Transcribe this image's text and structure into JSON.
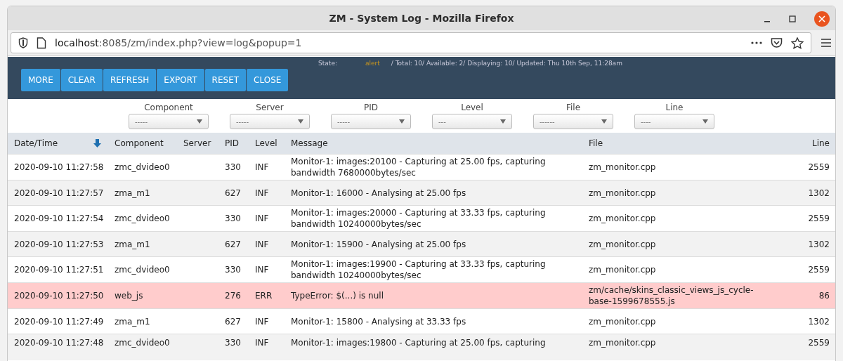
{
  "window": {
    "title": "ZM - System Log - Mozilla Firefox"
  },
  "address_bar": {
    "host": "localhost",
    "path": ":8085/zm/index.php?view=log&popup=1"
  },
  "status": {
    "label": "State:",
    "state": "alert",
    "summary": "/ Total: 10/ Available: 2/ Displaying: 10/ Updated: Thu 10th Sep, 11:28am"
  },
  "buttons": [
    "MORE",
    "CLEAR",
    "REFRESH",
    "EXPORT",
    "RESET",
    "CLOSE"
  ],
  "filters": [
    {
      "label": "Component",
      "value": "-----"
    },
    {
      "label": "Server",
      "value": "-----"
    },
    {
      "label": "PID",
      "value": "-----"
    },
    {
      "label": "Level",
      "value": "---"
    },
    {
      "label": "File",
      "value": "------"
    },
    {
      "label": "Line",
      "value": "----"
    }
  ],
  "table": {
    "columns": [
      "Date/Time",
      "Component",
      "Server",
      "PID",
      "Level",
      "Message",
      "File",
      "Line"
    ],
    "rows": [
      {
        "kind": "info",
        "cells": [
          "2020-09-10 11:27:58",
          "zmc_dvideo0",
          "",
          "330",
          "INF",
          "Monitor-1: images:20100 - Capturing at 25.00 fps, capturing bandwidth 7680000bytes/sec",
          "zm_monitor.cpp",
          "2559"
        ]
      },
      {
        "kind": "info",
        "cells": [
          "2020-09-10 11:27:57",
          "zma_m1",
          "",
          "627",
          "INF",
          "Monitor-1: 16000 - Analysing at 25.00 fps",
          "zm_monitor.cpp",
          "1302"
        ]
      },
      {
        "kind": "info",
        "cells": [
          "2020-09-10 11:27:54",
          "zmc_dvideo0",
          "",
          "330",
          "INF",
          "Monitor-1: images:20000 - Capturing at 33.33 fps, capturing bandwidth 10240000bytes/sec",
          "zm_monitor.cpp",
          "2559"
        ]
      },
      {
        "kind": "info",
        "cells": [
          "2020-09-10 11:27:53",
          "zma_m1",
          "",
          "627",
          "INF",
          "Monitor-1: 15900 - Analysing at 25.00 fps",
          "zm_monitor.cpp",
          "1302"
        ]
      },
      {
        "kind": "info",
        "cells": [
          "2020-09-10 11:27:51",
          "zmc_dvideo0",
          "",
          "330",
          "INF",
          "Monitor-1: images:19900 - Capturing at 33.33 fps, capturing bandwidth 10240000bytes/sec",
          "zm_monitor.cpp",
          "2559"
        ]
      },
      {
        "kind": "error",
        "cells": [
          "2020-09-10 11:27:50",
          "web_js",
          "",
          "276",
          "ERR",
          "TypeError: $(...) is null",
          "zm/cache/skins_classic_views_js_cycle-base-1599678555.js",
          "86"
        ]
      },
      {
        "kind": "info",
        "cells": [
          "2020-09-10 11:27:49",
          "zma_m1",
          "",
          "627",
          "INF",
          "Monitor-1: 15800 - Analysing at 33.33 fps",
          "zm_monitor.cpp",
          "1302"
        ]
      },
      {
        "kind": "info",
        "cells": [
          "2020-09-10 11:27:48",
          "zmc_dvideo0",
          "",
          "330",
          "INF",
          "Monitor-1: images:19800 - Capturing at 25.00 fps, capturing",
          "zm_monitor.cpp",
          "2559"
        ]
      }
    ]
  }
}
